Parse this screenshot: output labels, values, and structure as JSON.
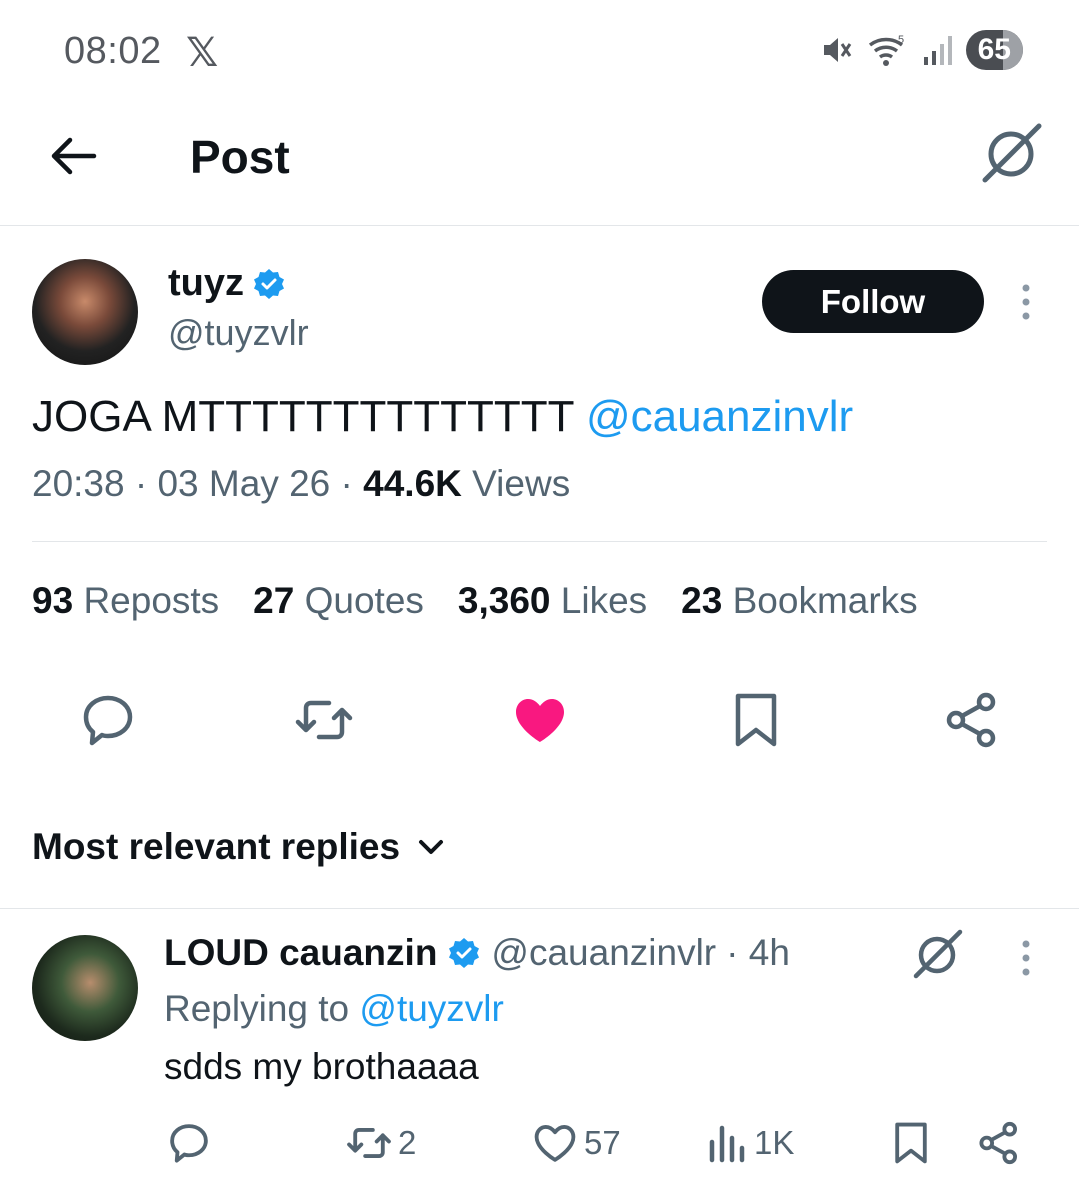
{
  "status_bar": {
    "time": "08:02",
    "app_icon": "x-logo-icon",
    "battery": "65"
  },
  "header": {
    "title": "Post",
    "back_icon": "arrow-left-icon",
    "grok_icon": "grok-icon"
  },
  "post": {
    "author_name": "tuyz",
    "author_handle": "@tuyzvlr",
    "follow_label": "Follow",
    "text": "JOGA MTTTTTTTTTTTTTT ",
    "mention": "@cauanzinvlr",
    "time": "20:38",
    "date": "03 May 26",
    "views_count": "44.6K",
    "views_label": "Views",
    "stats": {
      "reposts_count": "93",
      "reposts_label": "Reposts",
      "quotes_count": "27",
      "quotes_label": "Quotes",
      "likes_count": "3,360",
      "likes_label": "Likes",
      "bookmarks_count": "23",
      "bookmarks_label": "Bookmarks"
    },
    "like_color": "#f91880"
  },
  "replies": {
    "sort_label": "Most relevant replies",
    "items": [
      {
        "name": "LOUD cauanzin",
        "handle": "@cauanzinvlr",
        "age": "· 4h",
        "replying_prefix": "Replying to ",
        "replying_to": "@tuyzvlr",
        "text": "sdds my brothaaaa",
        "reposts": "2",
        "likes": "57",
        "views": "1K"
      }
    ]
  },
  "colors": {
    "accent": "#1d9bf0",
    "text": "#0f1419",
    "secondary": "#536471"
  }
}
